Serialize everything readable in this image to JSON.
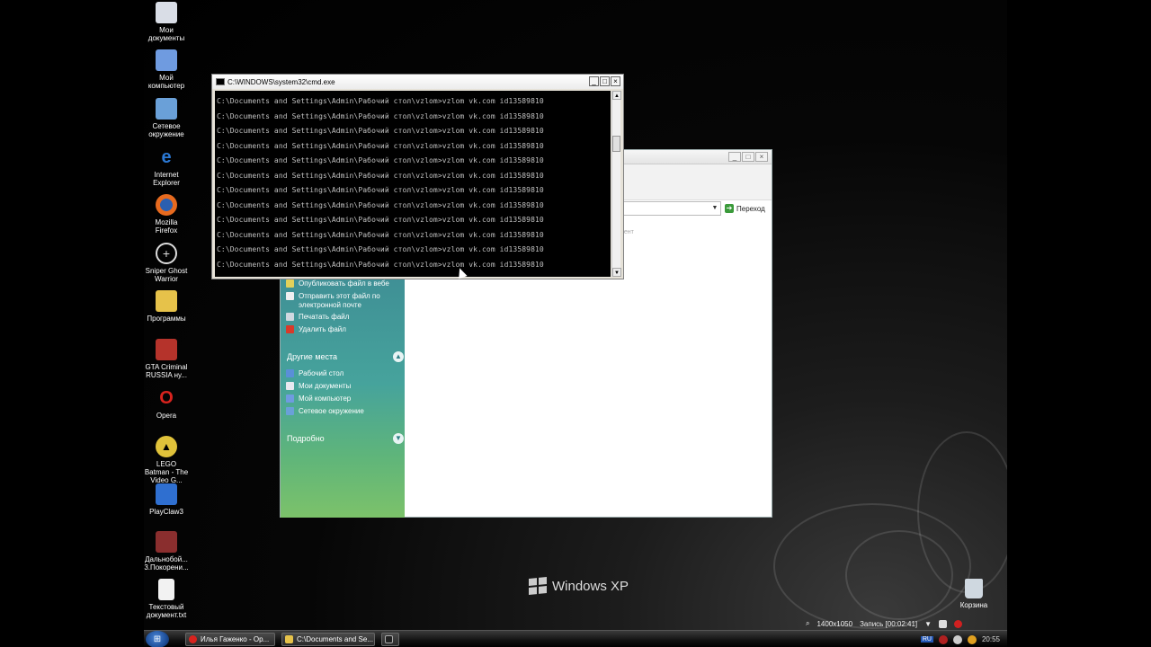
{
  "desktop": {
    "icons": [
      {
        "label": "Мои документы",
        "icon": "my-documents-icon",
        "color": "#d9dde6"
      },
      {
        "label": "Мой компьютер",
        "icon": "my-computer-icon",
        "color": "#6f9be0"
      },
      {
        "label": "Сетевое окружение",
        "icon": "network-icon",
        "color": "#6aa0d8"
      },
      {
        "label": "Internet Explorer",
        "icon": "internet-explorer-icon",
        "color": "#2b78d4"
      },
      {
        "label": "Mozilla Firefox",
        "icon": "firefox-icon",
        "color": "#e66a1f"
      },
      {
        "label": "Sniper Ghost Warrior",
        "icon": "crosshair-icon",
        "color": "#222222"
      },
      {
        "label": "Программы",
        "icon": "folder-icon",
        "color": "#e6c24a"
      },
      {
        "label": "GTA Criminal RUSSIA ну...",
        "icon": "gta-icon",
        "color": "#b5332b"
      },
      {
        "label": "Opera",
        "icon": "opera-icon",
        "color": "#d8231e"
      },
      {
        "label": "LEGO Batman - The Video G...",
        "icon": "batman-icon",
        "color": "#e0c23a"
      },
      {
        "label": "PlayClaw3",
        "icon": "playclaw-icon",
        "color": "#2f6fd0"
      },
      {
        "label": "Дальнобой... 3.Покорени...",
        "icon": "truck-icon",
        "color": "#8a2e2e"
      },
      {
        "label": "Текстовый документ.txt",
        "icon": "text-document-icon",
        "color": "#f2f2f2"
      }
    ],
    "recycle_bin": {
      "label": "Корзина",
      "icon": "recycle-bin-icon"
    },
    "os_logo": "Windows XP"
  },
  "explorer": {
    "go_label": "Переход",
    "faded_text": "мент",
    "file_tasks": [
      {
        "label": "Опубликовать файл в вебе",
        "icon": "publish-web-icon",
        "color": "#e2d15a"
      },
      {
        "label": "Отправить этот файл по электронной почте",
        "icon": "email-icon",
        "color": "#f0f0f0"
      },
      {
        "label": "Печатать файл",
        "icon": "printer-icon",
        "color": "#d0d8e0"
      },
      {
        "label": "Удалить файл",
        "icon": "delete-icon",
        "color": "#d83a2a"
      }
    ],
    "other_places_title": "Другие места",
    "other_places": [
      {
        "label": "Рабочий стол",
        "icon": "desktop-icon",
        "color": "#5a8fd8"
      },
      {
        "label": "Мои документы",
        "icon": "my-documents-icon",
        "color": "#e8e8f0"
      },
      {
        "label": "Мой компьютер",
        "icon": "my-computer-icon",
        "color": "#6f9be0"
      },
      {
        "label": "Сетевое окружение",
        "icon": "network-icon",
        "color": "#6aa0d8"
      }
    ],
    "details_title": "Подробно"
  },
  "cmd": {
    "title": "C:\\WINDOWS\\system32\\cmd.exe",
    "lines": [
      "C:\\Documents and Settings\\Admin\\Рабочий стол\\vzlom>vzlom vk.com id13589810",
      "C:\\Documents and Settings\\Admin\\Рабочий стол\\vzlom>vzlom vk.com id13589810",
      "C:\\Documents and Settings\\Admin\\Рабочий стол\\vzlom>vzlom vk.com id13589810",
      "C:\\Documents and Settings\\Admin\\Рабочий стол\\vzlom>vzlom vk.com id13589810",
      "C:\\Documents and Settings\\Admin\\Рабочий стол\\vzlom>vzlom vk.com id13589810",
      "C:\\Documents and Settings\\Admin\\Рабочий стол\\vzlom>vzlom vk.com id13589810",
      "C:\\Documents and Settings\\Admin\\Рабочий стол\\vzlom>vzlom vk.com id13589810",
      "C:\\Documents and Settings\\Admin\\Рабочий стол\\vzlom>vzlom vk.com id13589810",
      "C:\\Documents and Settings\\Admin\\Рабочий стол\\vzlom>vzlom vk.com id13589810",
      "C:\\Documents and Settings\\Admin\\Рабочий стол\\vzlom>vzlom vk.com id13589810",
      "C:\\Documents and Settings\\Admin\\Рабочий стол\\vzlom>vzlom vk.com id13589810",
      "C:\\Documents and Settings\\Admin\\Рабочий стол\\vzlom>vzlom vk.com id13589810"
    ]
  },
  "recorder": {
    "resolution": "1400x1050",
    "status": "Запись [00:02:41]"
  },
  "taskbar": {
    "tasks": [
      {
        "label": "Илья Гаженко - Op...",
        "icon": "opera-icon",
        "color": "#d8231e"
      },
      {
        "label": "C:\\Documents and Se...",
        "icon": "folder-icon",
        "color": "#e6c24a"
      },
      {
        "label": "",
        "icon": "cmd-icon",
        "color": "#222222"
      }
    ],
    "language": "RU",
    "clock": "20:55"
  }
}
